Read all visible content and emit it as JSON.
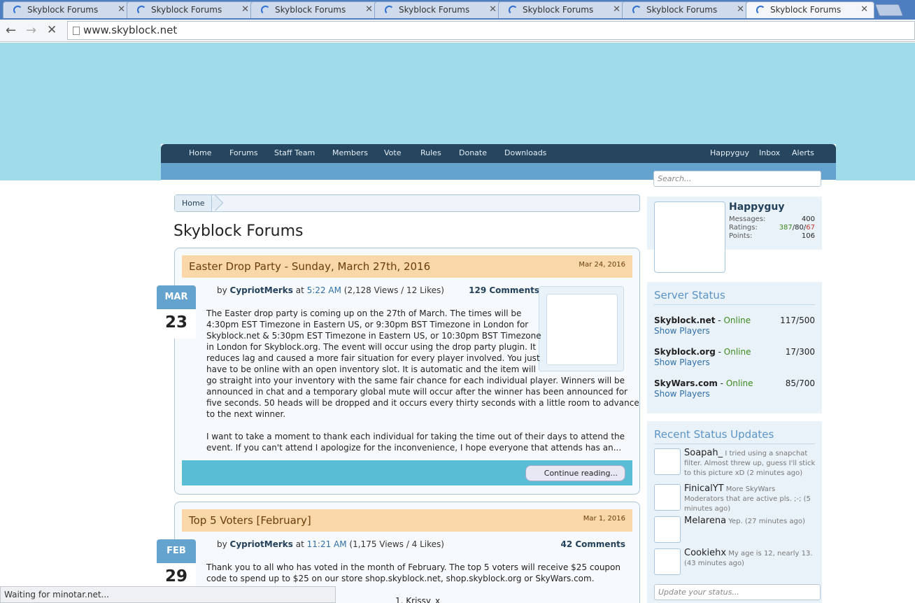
{
  "browser": {
    "tabs": [
      {
        "title": "Skyblock Forums",
        "close": "✕"
      },
      {
        "title": "Skyblock Forums",
        "close": "✕"
      },
      {
        "title": "Skyblock Forums",
        "close": "✕"
      },
      {
        "title": "Skyblock Forums",
        "close": "✕"
      },
      {
        "title": "Skyblock Forums",
        "close": "✕"
      },
      {
        "title": "Skyblock Forums",
        "close": "✕"
      },
      {
        "title": "Skyblock Forums",
        "close": "✕"
      }
    ],
    "url": "www.skyblock.net",
    "back_glyph": "←",
    "forward_glyph": "→",
    "stop_glyph": "✕",
    "status_text": "Waiting for minotar.net..."
  },
  "nav": {
    "left": [
      "Home",
      "Forums",
      "Staff Team",
      "Members",
      "Vote",
      "Rules",
      "Donate",
      "Downloads"
    ],
    "right": [
      "Happyguy",
      "Inbox",
      "Alerts"
    ]
  },
  "breadcrumb": {
    "home": "Home"
  },
  "page_title": "Skyblock Forums",
  "posts": [
    {
      "title": "Easter Drop Party - Sunday, March 27th, 2016",
      "date": "Mar 24, 2016",
      "badge_month": "MAR",
      "badge_day": "23",
      "by": "by",
      "author": "CypriotMerks",
      "at": "at",
      "time": "5:22 AM",
      "stats": "(2,128 Views / 12 Likes)",
      "comments": "129 Comments",
      "body_lines": [
        "The Easter drop party is coming up on the 27th of March. The times will be",
        "4:30pm EST Timezone in Eastern US, or 9:30pm BST Timezone in London for",
        "Skyblock.net & 5:30pm EST Timezone in Eastern US, or 10:30pm BST Timezone",
        "in London for Skyblock.org. The event will occur using the drop party plugin. It",
        "reduces lag and caused a more fair situation for every player involved. You just",
        "have to be online with an open inventory slot. It is automatic and the item will",
        "go straight into your inventory with the same fair chance for each individual player. Winners will be",
        "announced in chat and a temporary global mute will occur after the winner has been announced for",
        "five seconds. 50 heads will be dropped and it occurs every thirty seconds with a little room to advance",
        "to the next winner.",
        "",
        "I want to take a moment to thank each individual for taking the time out of their days to attend the",
        "event. If you can't attend I apologize for the inconvenience, I hope everyone that attends has an..."
      ],
      "continue": "Continue reading..."
    },
    {
      "title": "Top 5 Voters [February]",
      "date": "Mar 1, 2016",
      "badge_month": "FEB",
      "badge_day": "29",
      "by": "by",
      "author": "CypriotMerks",
      "at": "at",
      "time": "11:21 AM",
      "stats": "(1,175 Views / 4 Likes)",
      "comments": "42 Comments",
      "body_lines": [
        "Thank you to all who has voted in the month of February. The top 5 voters will receive $25 coupon",
        "code to spend up to $25 on our store shop.skyblock.net, shop.skyblock.org or SkyWars.com.",
        "",
        "1. Krissy_x"
      ]
    }
  ],
  "sidebar": {
    "search_placeholder": "Search...",
    "user": {
      "name": "Happyguy",
      "messages_label": "Messages:",
      "messages": "400",
      "ratings_label": "Ratings:",
      "ratings_pos": "387",
      "ratings_neu": "80",
      "ratings_neg": "67",
      "points_label": "Points:",
      "points": "106"
    },
    "server_status": {
      "heading": "Server Status",
      "servers": [
        {
          "name": "Skyblock.net",
          "status": "Online",
          "count": "117/500",
          "link": "Show Players"
        },
        {
          "name": "Skyblock.org",
          "status": "Online",
          "count": "17/300",
          "link": "Show Players"
        },
        {
          "name": "SkyWars.com",
          "status": "Online",
          "count": "85/700",
          "link": "Show Players"
        }
      ]
    },
    "recent": {
      "heading": "Recent Status Updates",
      "items": [
        {
          "name": "Soapah_",
          "text": "I tried using a snapchat filter. Almost threw up, guess I'll stick to this picture xD (2 minutes ago)"
        },
        {
          "name": "FinicalYT",
          "text": "More SkyWars Moderators that are active pls. ;-; (5 minutes ago)"
        },
        {
          "name": "Melarena",
          "text": "Yep. (27 minutes ago)"
        },
        {
          "name": "Cookiehx",
          "text": "My age is 12, nearly 13. (43 minutes ago)"
        }
      ],
      "input_placeholder": "Update your status..."
    }
  }
}
